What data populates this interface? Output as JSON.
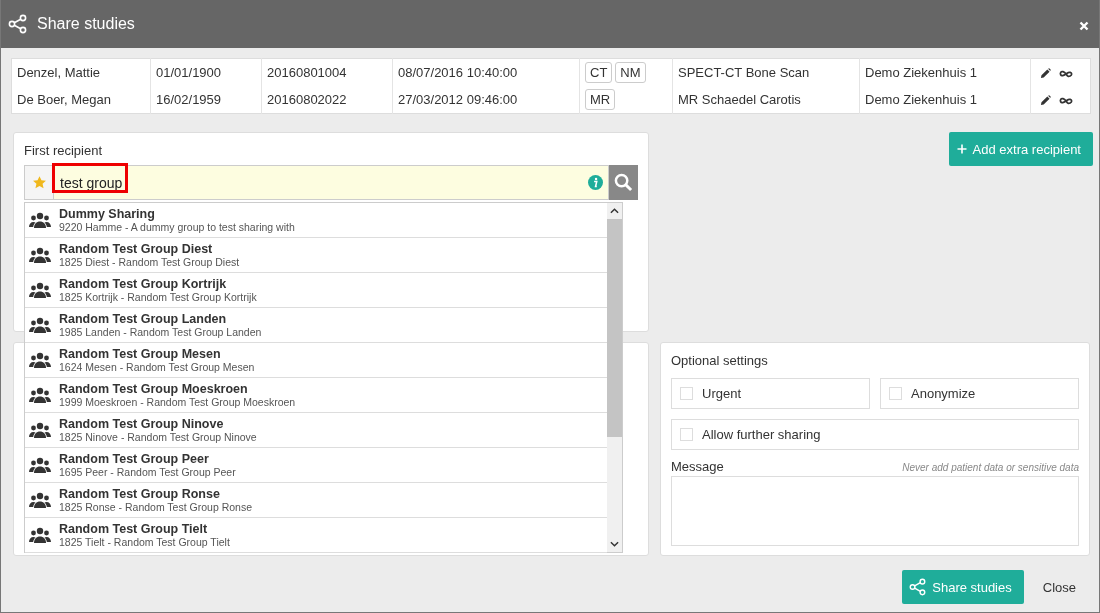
{
  "window": {
    "title": "Share studies"
  },
  "studies": [
    {
      "patient": "Denzel, Mattie",
      "birth_date": "01/01/1900",
      "accession": "20160801004",
      "study_date": "08/07/2016 10:40:00",
      "modalities": [
        "CT",
        "NM"
      ],
      "description": "SPECT-CT Bone Scan",
      "institution": "Demo Ziekenhuis 1"
    },
    {
      "patient": "De Boer, Megan",
      "birth_date": "16/02/1959",
      "accession": "20160802022",
      "study_date": "27/03/2012 09:46:00",
      "modalities": [
        "MR"
      ],
      "description": "MR Schaedel Carotis",
      "institution": "Demo Ziekenhuis 1"
    }
  ],
  "first_recipient": {
    "label": "First recipient",
    "query": "test group",
    "suggestions": [
      {
        "name": "Dummy Sharing",
        "detail": "9220 Hamme - A dummy group to test sharing with"
      },
      {
        "name": "Random Test Group Diest",
        "detail": "1825 Diest - Random Test Group Diest"
      },
      {
        "name": "Random Test Group Kortrijk",
        "detail": "1825 Kortrijk - Random Test Group Kortrijk"
      },
      {
        "name": "Random Test Group Landen",
        "detail": "1985 Landen - Random Test Group Landen"
      },
      {
        "name": "Random Test Group Mesen",
        "detail": "1624 Mesen - Random Test Group Mesen"
      },
      {
        "name": "Random Test Group Moeskroen",
        "detail": "1999 Moeskroen - Random Test Group Moeskroen"
      },
      {
        "name": "Random Test Group Ninove",
        "detail": "1825 Ninove - Random Test Group Ninove"
      },
      {
        "name": "Random Test Group Peer",
        "detail": "1695 Peer - Random Test Group Peer"
      },
      {
        "name": "Random Test Group Ronse",
        "detail": "1825 Ronse - Random Test Group Ronse"
      },
      {
        "name": "Random Test Group Tielt",
        "detail": "1825 Tielt - Random Test Group Tielt"
      }
    ]
  },
  "add_recipient_button": "Add extra recipient",
  "optional_settings": {
    "title": "Optional settings",
    "options": [
      {
        "label": "Urgent",
        "checked": false
      },
      {
        "label": "Anonymize",
        "checked": false
      },
      {
        "label": "Allow further sharing",
        "checked": false
      }
    ],
    "message_label": "Message",
    "message_hint": "Never add patient data or sensitive data"
  },
  "footer": {
    "share_button": "Share studies",
    "close_button": "Close"
  }
}
